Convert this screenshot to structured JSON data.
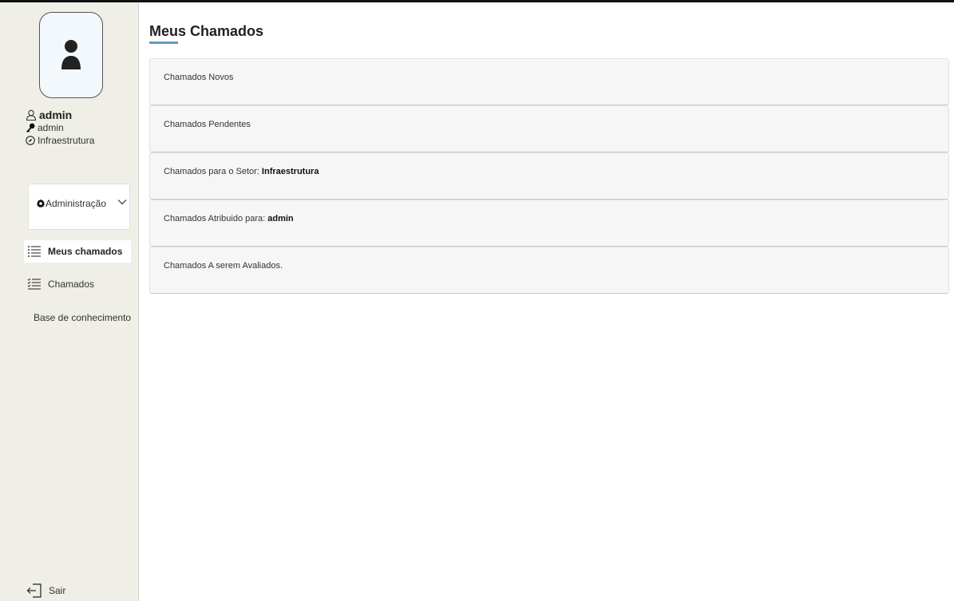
{
  "sidebar": {
    "user": {
      "name": "admin",
      "login": "admin",
      "sector": "Infraestrutura"
    },
    "admin_menu": {
      "label": "Administração"
    },
    "nav": [
      {
        "label": "Meus chamados",
        "icon": "list-icon"
      },
      {
        "label": "Chamados",
        "icon": "checklist-icon"
      },
      {
        "label": "Base de conhecimento",
        "icon": "notebook-icon"
      }
    ],
    "logout": {
      "label": "Sair",
      "icon": "logout-icon"
    }
  },
  "main": {
    "title": "Meus Chamados",
    "cards": [
      {
        "label": "Chamados Novos"
      },
      {
        "label": "Chamados Pendentes"
      },
      {
        "label": "Chamados para o Setor:",
        "value": "Infraestrutura"
      },
      {
        "label": "Chamados Atribuido para:",
        "value": "admin"
      },
      {
        "label": "Chamados A serem Avaliados."
      }
    ]
  },
  "colors": {
    "sidebar_bg": "#efeee7",
    "accent": "#5f9db4",
    "card_bg": "#f6f6f6"
  }
}
